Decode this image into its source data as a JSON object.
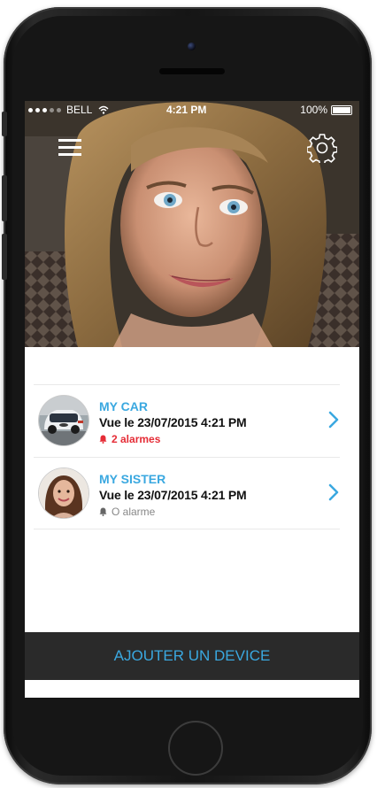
{
  "status_bar": {
    "carrier": "BELL",
    "time": "4:21 PM",
    "battery": "100%"
  },
  "header": {
    "menu_icon": "hamburger-menu-icon",
    "settings_icon": "gear-icon"
  },
  "devices": [
    {
      "name": "MY CAR",
      "seen": "Vue le 23/07/2015 4:21 PM",
      "alarms": "2 alarmes",
      "alarm_color": "#e52c36",
      "icon": "chevron-right-icon"
    },
    {
      "name": "MY SISTER",
      "seen": "Vue le 23/07/2015 4:21 PM",
      "alarms": "O alarme",
      "alarm_color": "#888888",
      "icon": "chevron-right-icon"
    }
  ],
  "footer": {
    "add_device_label": "AJOUTER UN DEVICE"
  },
  "colors": {
    "accent": "#3aa8e0",
    "alert": "#e52c36",
    "footer_bg": "#2a2a2a"
  }
}
